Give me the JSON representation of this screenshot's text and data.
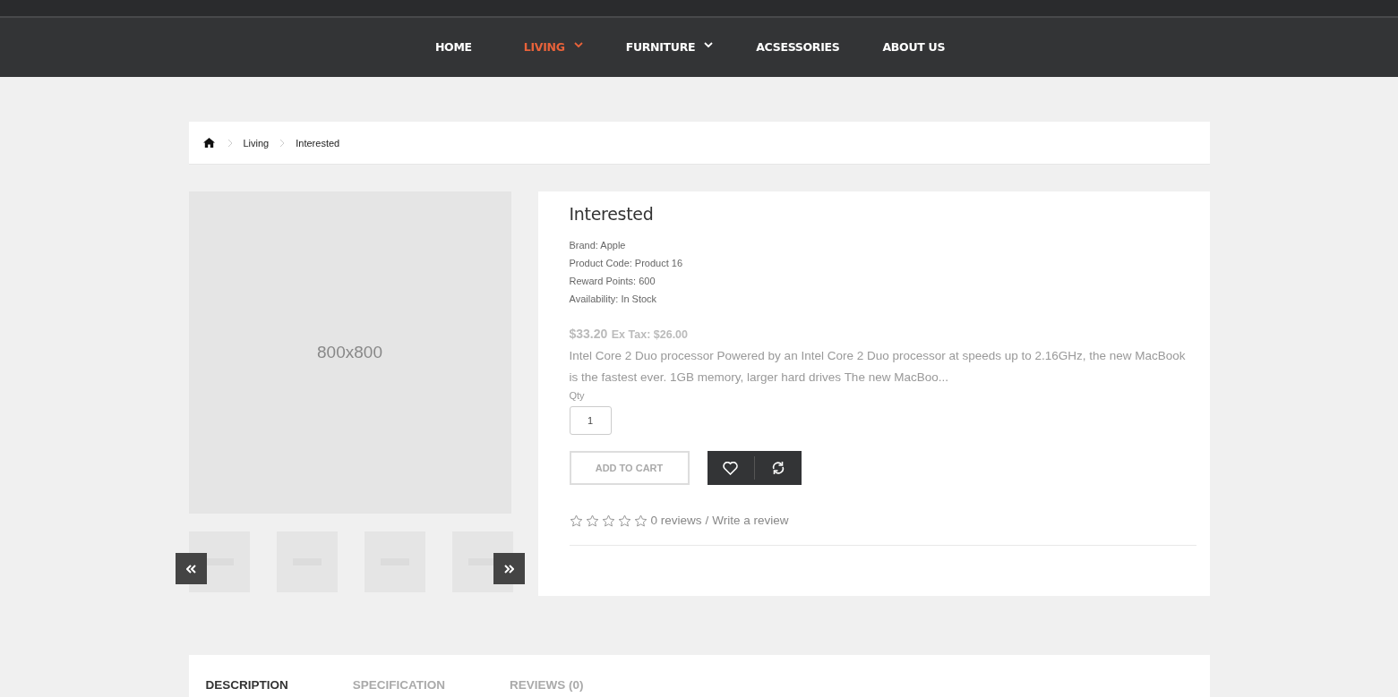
{
  "nav": [
    {
      "label": "HOME",
      "selected": false,
      "dropdown": false
    },
    {
      "label": "LIVING",
      "selected": true,
      "dropdown": true
    },
    {
      "label": "FURNITURE",
      "selected": false,
      "dropdown": true
    },
    {
      "label": "ACSESSORIES",
      "selected": false,
      "dropdown": false
    },
    {
      "label": "ABOUT US",
      "selected": false,
      "dropdown": false
    }
  ],
  "breadcrumb": [
    "Living",
    "Interested"
  ],
  "main_image": {
    "label": "800x800"
  },
  "thumbnails": [
    {
      "kind": "picture"
    },
    {
      "kind": "picture"
    },
    {
      "kind": "picture"
    },
    {
      "kind": "picture"
    }
  ],
  "product": {
    "title": "Interested",
    "details": [
      "Brand: Apple",
      "Product Code: Product 16",
      "Reward Points: 600",
      "Availability: In Stock"
    ],
    "price": "$33.20",
    "ex_tax": "Ex Tax: $26.00",
    "description": "Intel Core 2 Duo processor Powered by an Intel Core 2 Duo processor at speeds up to 2.16GHz, the new MacBook is the fastest ever. 1GB memory, larger hard drives The new MacBoo...",
    "qty_label": "Qty",
    "qty": "1",
    "add_to_cart": "ADD TO CART",
    "stars": 0,
    "reviews": "0 reviews",
    "separator": "/",
    "write_review": "Write a review"
  },
  "tabs": [
    {
      "label": "DESCRIPTION",
      "selected": true
    },
    {
      "label": "SPECIFICATION",
      "selected": false
    },
    {
      "label": "REVIEWS (0)",
      "selected": false
    }
  ]
}
